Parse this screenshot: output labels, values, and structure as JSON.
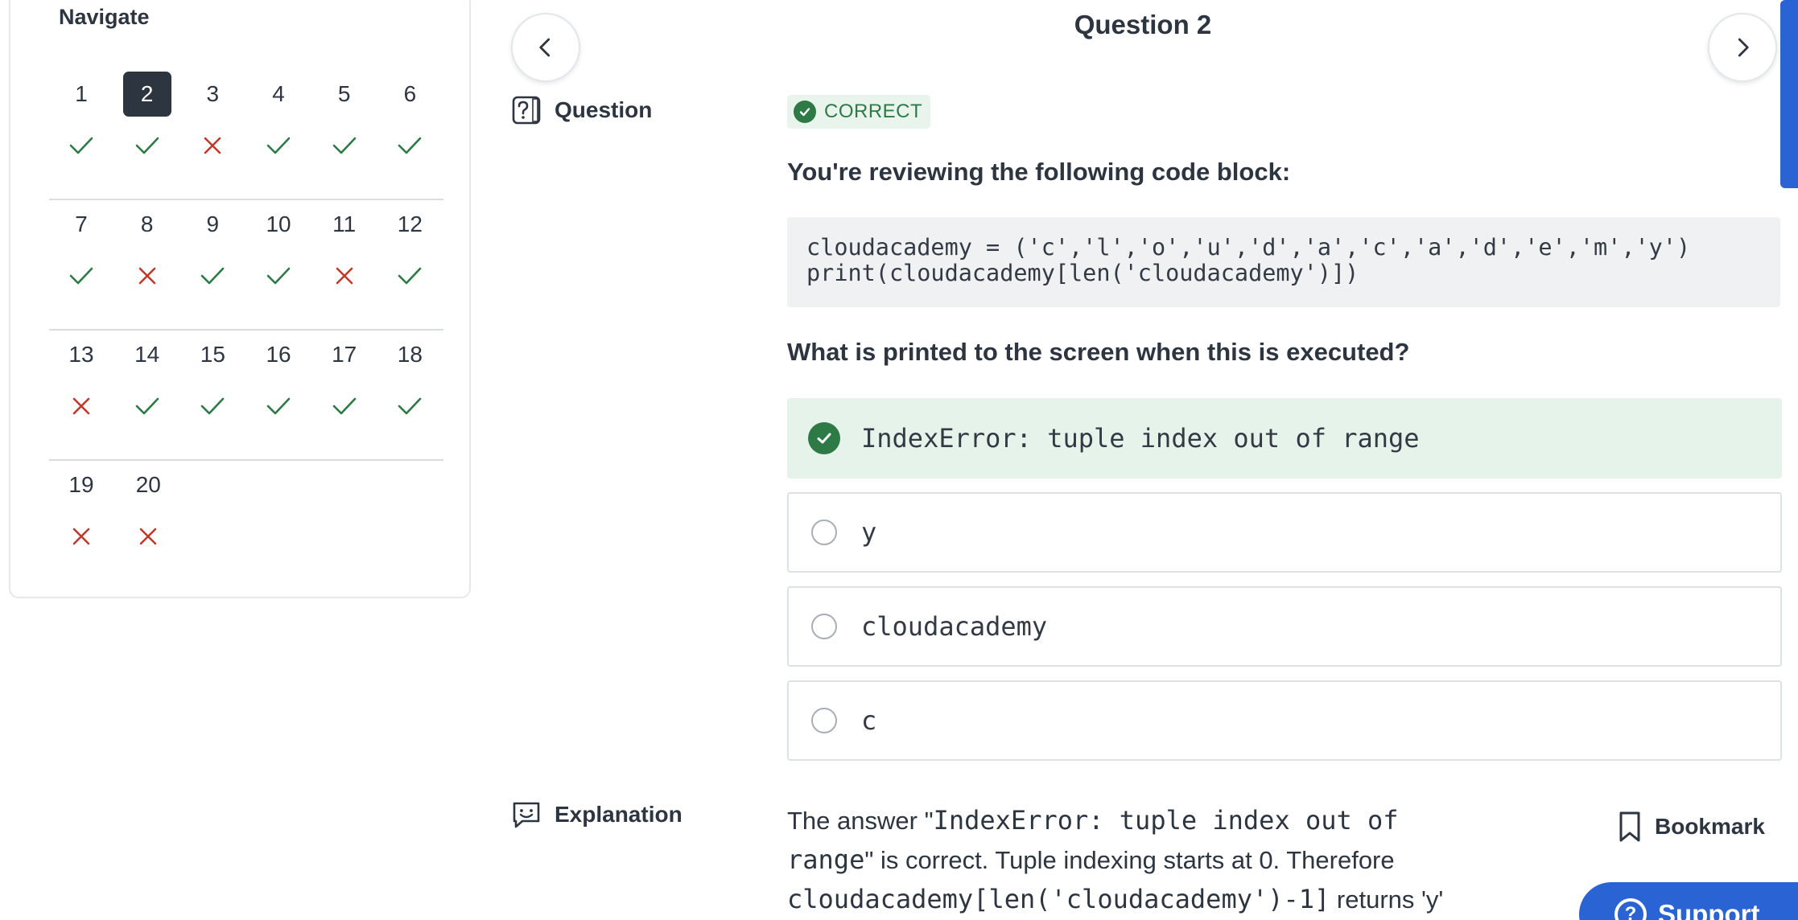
{
  "navigate": {
    "title": "Navigate",
    "current": 2,
    "questions": [
      {
        "n": "1",
        "result": "correct"
      },
      {
        "n": "2",
        "result": "correct"
      },
      {
        "n": "3",
        "result": "incorrect"
      },
      {
        "n": "4",
        "result": "correct"
      },
      {
        "n": "5",
        "result": "correct"
      },
      {
        "n": "6",
        "result": "correct"
      },
      {
        "n": "7",
        "result": "correct"
      },
      {
        "n": "8",
        "result": "incorrect"
      },
      {
        "n": "9",
        "result": "correct"
      },
      {
        "n": "10",
        "result": "correct"
      },
      {
        "n": "11",
        "result": "incorrect"
      },
      {
        "n": "12",
        "result": "correct"
      },
      {
        "n": "13",
        "result": "incorrect"
      },
      {
        "n": "14",
        "result": "correct"
      },
      {
        "n": "15",
        "result": "correct"
      },
      {
        "n": "16",
        "result": "correct"
      },
      {
        "n": "17",
        "result": "correct"
      },
      {
        "n": "18",
        "result": "correct"
      },
      {
        "n": "19",
        "result": "incorrect"
      },
      {
        "n": "20",
        "result": "incorrect"
      }
    ]
  },
  "header": {
    "title": "Question 2"
  },
  "question": {
    "label": "Question",
    "status": "CORRECT",
    "intro": "You're reviewing the following code block:",
    "code_line1": "cloudacademy = ('c','l','o','u','d','a','c','a','d','e','m','y')",
    "code_line2": "print(cloudacademy[len('cloudacademy')])",
    "prompt": "What is printed to the screen when this is executed?",
    "answers": [
      {
        "text": "IndexError: tuple index out of range",
        "selected": true
      },
      {
        "text": "y",
        "selected": false
      },
      {
        "text": "cloudacademy",
        "selected": false
      },
      {
        "text": "c",
        "selected": false
      }
    ]
  },
  "explanation": {
    "label": "Explanation",
    "p1": "The answer \"",
    "mono1": "IndexError: tuple index out of range",
    "p2": "\" is correct. Tuple indexing starts at 0. Therefore ",
    "mono2": "cloudacademy[len('cloudacademy')-1]",
    "p3": " returns 'y'"
  },
  "bookmark": {
    "label": "Bookmark"
  },
  "support": {
    "label": "Support"
  },
  "colors": {
    "correct": "#2e7a47",
    "incorrect": "#c0392b",
    "accent": "#2a63d4",
    "dark": "#2d3540"
  }
}
